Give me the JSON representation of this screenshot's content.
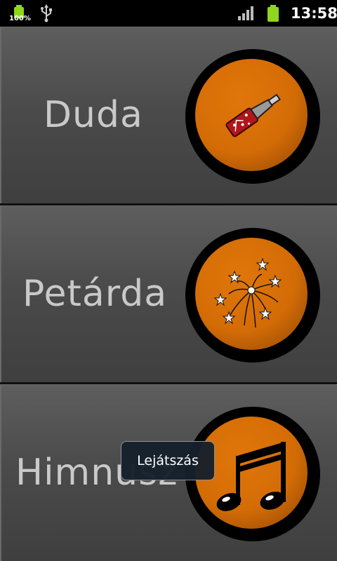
{
  "status_bar": {
    "battery_percent": "100%",
    "clock": "13:58",
    "icons": [
      "battery-icon",
      "usb-icon",
      "signal-icon",
      "battery-icon"
    ],
    "battery_color": "#8fd61c"
  },
  "sounds": [
    {
      "label": "Duda",
      "icon": "horn-icon"
    },
    {
      "label": "Petárda",
      "icon": "firework-icon"
    },
    {
      "label": "Himnusz",
      "icon": "music-note-icon"
    }
  ],
  "toast": {
    "text": "Lejátszás"
  },
  "colors": {
    "tile_bg": "#4b4b4b",
    "label": "#c9c9c9",
    "button_orange": "#d46c06",
    "button_ring": "#000000"
  }
}
